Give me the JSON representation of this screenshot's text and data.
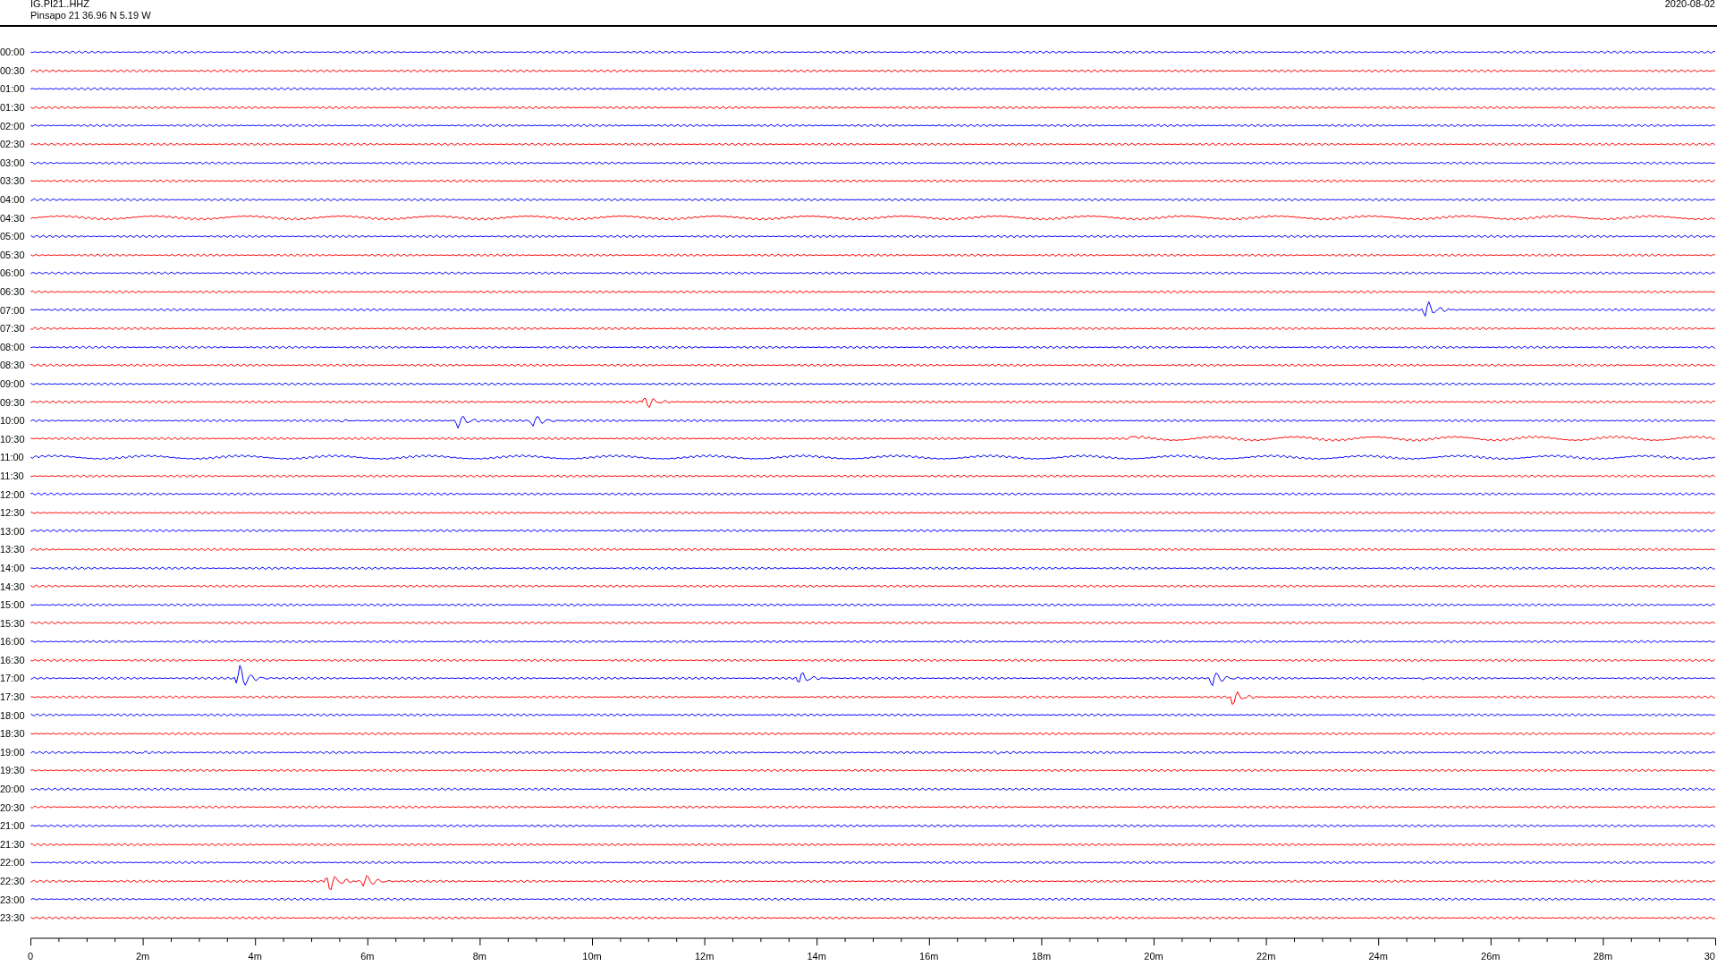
{
  "header": {
    "station": "IG.PI21..HHZ",
    "location": "Pinsapo 21  36.96 N 5.19 W",
    "date": "2020-08-02"
  },
  "rows": [
    {
      "label": "00:00",
      "color": "#0000ff"
    },
    {
      "label": "00:30",
      "color": "#ff0000"
    },
    {
      "label": "01:00",
      "color": "#0000ff"
    },
    {
      "label": "01:30",
      "color": "#ff0000"
    },
    {
      "label": "02:00",
      "color": "#0000ff"
    },
    {
      "label": "02:30",
      "color": "#ff0000"
    },
    {
      "label": "03:00",
      "color": "#0000ff"
    },
    {
      "label": "03:30",
      "color": "#ff0000"
    },
    {
      "label": "04:00",
      "color": "#0000ff"
    },
    {
      "label": "04:30",
      "color": "#ff0000"
    },
    {
      "label": "05:00",
      "color": "#0000ff"
    },
    {
      "label": "05:30",
      "color": "#ff0000"
    },
    {
      "label": "06:00",
      "color": "#0000ff"
    },
    {
      "label": "06:30",
      "color": "#ff0000"
    },
    {
      "label": "07:00",
      "color": "#0000ff"
    },
    {
      "label": "07:30",
      "color": "#ff0000"
    },
    {
      "label": "08:00",
      "color": "#0000ff"
    },
    {
      "label": "08:30",
      "color": "#ff0000"
    },
    {
      "label": "09:00",
      "color": "#0000ff"
    },
    {
      "label": "09:30",
      "color": "#ff0000"
    },
    {
      "label": "10:00",
      "color": "#0000ff"
    },
    {
      "label": "10:30",
      "color": "#ff0000"
    },
    {
      "label": "11:00",
      "color": "#0000ff"
    },
    {
      "label": "11:30",
      "color": "#ff0000"
    },
    {
      "label": "12:00",
      "color": "#0000ff"
    },
    {
      "label": "12:30",
      "color": "#ff0000"
    },
    {
      "label": "13:00",
      "color": "#0000ff"
    },
    {
      "label": "13:30",
      "color": "#ff0000"
    },
    {
      "label": "14:00",
      "color": "#0000ff"
    },
    {
      "label": "14:30",
      "color": "#ff0000"
    },
    {
      "label": "15:00",
      "color": "#0000ff"
    },
    {
      "label": "15:30",
      "color": "#ff0000"
    },
    {
      "label": "16:00",
      "color": "#0000ff"
    },
    {
      "label": "16:30",
      "color": "#ff0000"
    },
    {
      "label": "17:00",
      "color": "#0000ff"
    },
    {
      "label": "17:30",
      "color": "#ff0000"
    },
    {
      "label": "18:00",
      "color": "#0000ff"
    },
    {
      "label": "18:30",
      "color": "#ff0000"
    },
    {
      "label": "19:00",
      "color": "#0000ff"
    },
    {
      "label": "19:30",
      "color": "#ff0000"
    },
    {
      "label": "20:00",
      "color": "#0000ff"
    },
    {
      "label": "20:30",
      "color": "#ff0000"
    },
    {
      "label": "21:00",
      "color": "#0000ff"
    },
    {
      "label": "21:30",
      "color": "#ff0000"
    },
    {
      "label": "22:00",
      "color": "#0000ff"
    },
    {
      "label": "22:30",
      "color": "#ff0000"
    },
    {
      "label": "23:00",
      "color": "#0000ff"
    },
    {
      "label": "23:30",
      "color": "#ff0000"
    }
  ],
  "axis": {
    "labels": [
      "0",
      "2m",
      "4m",
      "6m",
      "8m",
      "10m",
      "12m",
      "14m",
      "16m",
      "18m",
      "20m",
      "22m",
      "24m",
      "26m",
      "28m",
      "30"
    ]
  }
}
